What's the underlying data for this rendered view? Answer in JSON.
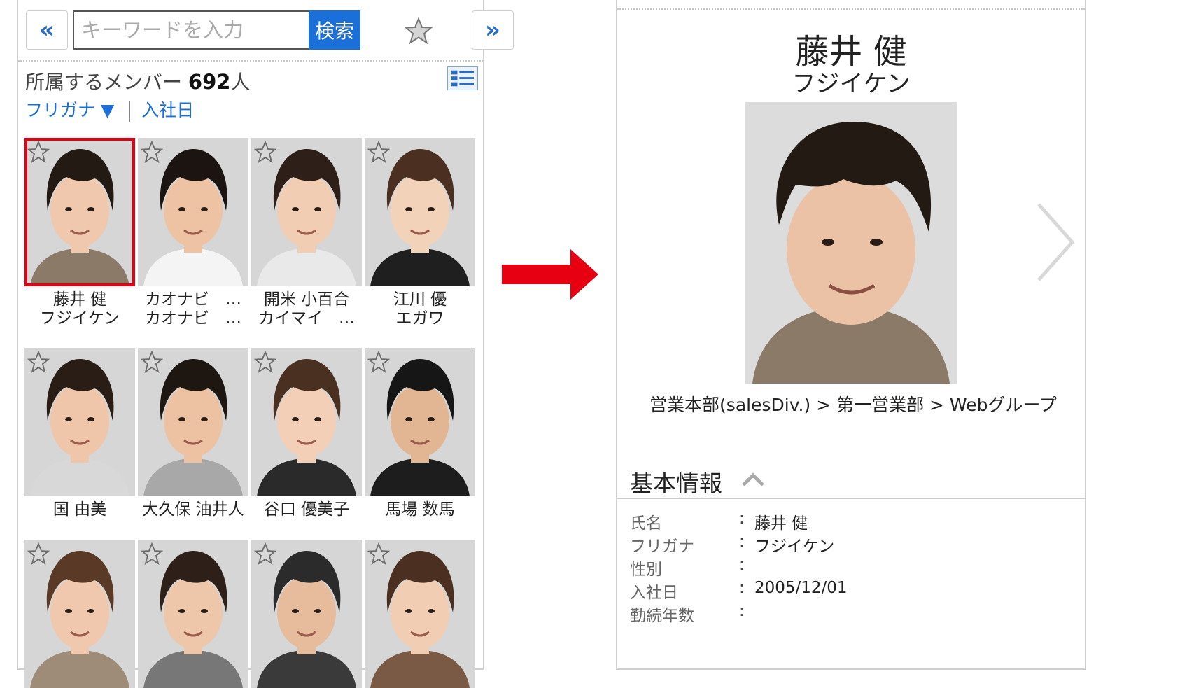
{
  "search": {
    "placeholder": "キーワードを入力",
    "button_label": "検索"
  },
  "member_count": {
    "label": "所属するメンバー",
    "count": "692",
    "unit": "人"
  },
  "sort": {
    "kana_label": "フリガナ ▼",
    "date_label": "入社日"
  },
  "members": [
    {
      "name": "藤井 健",
      "kana": "フジイケン",
      "selected": true
    },
    {
      "name": "カオナビ　…",
      "kana": "カオナビ　…"
    },
    {
      "name": "開米 小百合",
      "kana": "カイマイ　…"
    },
    {
      "name": "江川 優",
      "kana": "エガワ"
    },
    {
      "name": "国 由美",
      "kana": ""
    },
    {
      "name": "大久保 油井人",
      "kana": ""
    },
    {
      "name": "谷口 優美子",
      "kana": ""
    },
    {
      "name": "馬場 数馬",
      "kana": ""
    },
    {
      "name": "",
      "kana": ""
    },
    {
      "name": "",
      "kana": ""
    },
    {
      "name": "",
      "kana": ""
    },
    {
      "name": "",
      "kana": ""
    }
  ],
  "detail": {
    "name": "藤井 健",
    "kana": "フジイケン",
    "breadcrumb": "営業本部(salesDiv.) > 第一営業部 > Webグループ",
    "section_title": "基本情報",
    "fields": [
      {
        "label": "氏名",
        "value": "藤井 健"
      },
      {
        "label": "フリガナ",
        "value": "フジイケン"
      },
      {
        "label": "性別",
        "value": ""
      },
      {
        "label": "入社日",
        "value": "2005/12/01"
      },
      {
        "label": "勤続年数",
        "value": ""
      }
    ]
  },
  "colors": {
    "accent": "#1a6fd8",
    "highlight": "#e60012",
    "arrow": "#e60012"
  },
  "icons": [
    "prev-page-icon",
    "next-page-icon",
    "favorite-star-icon",
    "list-view-icon",
    "next-chevron-icon",
    "collapse-chevron-icon",
    "red-arrow-icon"
  ]
}
